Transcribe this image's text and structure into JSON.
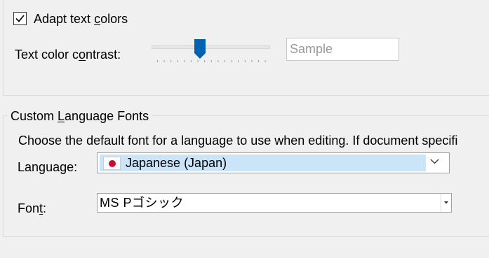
{
  "display": {
    "adapt_text_colors": {
      "label_pre": "Adapt text ",
      "label_accel": "c",
      "label_post": "olors",
      "checked": true
    },
    "contrast": {
      "label_pre": "Text color c",
      "label_accel": "o",
      "label_post": "ntrast:",
      "slider_value_fraction": 0.4,
      "sample_text": "Sample"
    }
  },
  "custom_fonts": {
    "title_pre": "Custom ",
    "title_accel": "L",
    "title_post": "anguage Fonts",
    "description": "Choose the default font for a language to use when editing. If document specifi",
    "language": {
      "label_pre": "Lan",
      "label_accel": "g",
      "label_post": "uage:",
      "value": "Japanese (Japan)",
      "flag_icon": "japan-flag-icon",
      "highlight_color": "#cce4f7"
    },
    "font": {
      "label_pre": "Fon",
      "label_accel": "t",
      "label_post": ":",
      "value": "MS Pゴシック"
    }
  },
  "colors": {
    "accent": "#0063b1",
    "flag_red": "#c8102e"
  }
}
